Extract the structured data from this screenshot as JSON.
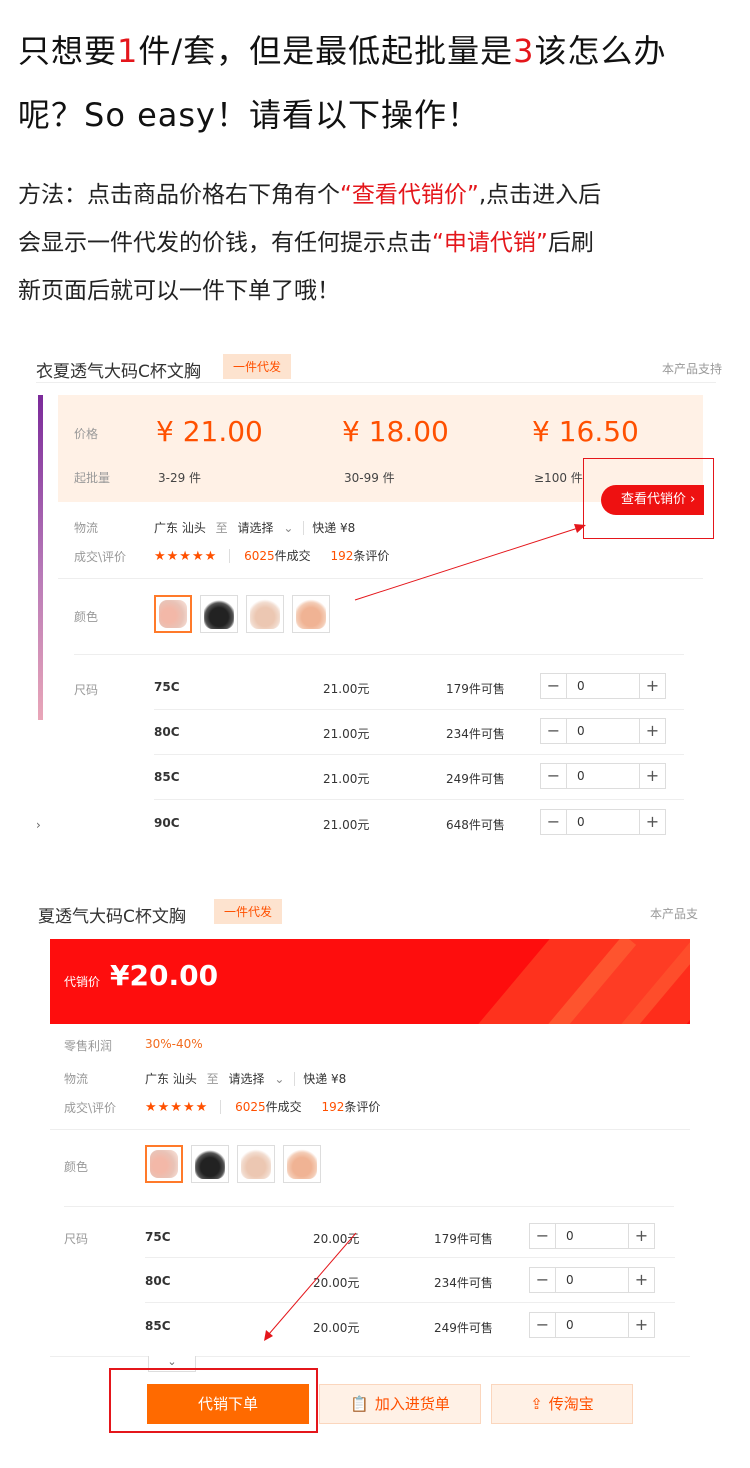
{
  "intro": {
    "line1_a": "只想要",
    "line1_num": "1",
    "line1_b": "件/套，但是最低起批量是",
    "line1_num2": "3",
    "line1_c": "该怎么办",
    "line2": "呢？So easy！请看以下操作！",
    "desc1_a": "方法：点击商品价格右下角有个",
    "desc1_q": "“查看代销价”",
    "desc1_b": ",点击进入后",
    "desc2_a": "会显示一件代发的价钱，有任何提示点击",
    "desc2_q": "“申请代销”",
    "desc2_b": "后刷",
    "desc3": "新页面后就可以一件下单了哦！"
  },
  "shot1": {
    "title": "衣夏透气大码C杯文胸",
    "badge": "一件代发",
    "support": "本产品支持",
    "price_label": "价格",
    "moq_label": "起批量",
    "prices": [
      {
        "price": "¥ 21.00",
        "moq": "3-29 件"
      },
      {
        "price": "¥ 18.00",
        "moq": "30-99 件"
      },
      {
        "price": "¥ 16.50",
        "moq": "≥100 件"
      }
    ],
    "cta": "查看代销价 ›",
    "logistics_label": "物流",
    "logistics_from": "广东 汕头",
    "logistics_to_word": "至",
    "logistics_dest": "请选择",
    "express": "快递 ¥8",
    "deal_label": "成交\\评价",
    "stars": "★★★★★",
    "deals_num": "6025",
    "deals_unit": "件成交",
    "reviews_num": "192",
    "reviews_unit": "条评价",
    "color_label": "颜色",
    "size_label": "尺码",
    "sizes": [
      {
        "size": "75C",
        "price": "21.00元",
        "stock": "179件可售",
        "qty": "0"
      },
      {
        "size": "80C",
        "price": "21.00元",
        "stock": "234件可售",
        "qty": "0"
      },
      {
        "size": "85C",
        "price": "21.00元",
        "stock": "249件可售",
        "qty": "0"
      },
      {
        "size": "90C",
        "price": "21.00元",
        "stock": "648件可售",
        "qty": "0"
      }
    ]
  },
  "shot2": {
    "title": "夏透气大码C杯文胸",
    "badge": "一件代发",
    "support": "本产品支",
    "dropship_label": "代销价",
    "dropship_price": "¥20.00",
    "profit_label": "零售利润",
    "profit_value": "30%-40%",
    "logistics_label": "物流",
    "logistics_from": "广东 汕头",
    "logistics_to_word": "至",
    "logistics_dest": "请选择",
    "express": "快递 ¥8",
    "deal_label": "成交\\评价",
    "stars": "★★★★★",
    "deals_num": "6025",
    "deals_unit": "件成交",
    "reviews_num": "192",
    "reviews_unit": "条评价",
    "color_label": "颜色",
    "size_label": "尺码",
    "sizes": [
      {
        "size": "75C",
        "price": "20.00元",
        "stock": "179件可售",
        "qty": "0"
      },
      {
        "size": "80C",
        "price": "20.00元",
        "stock": "234件可售",
        "qty": "0"
      },
      {
        "size": "85C",
        "price": "20.00元",
        "stock": "249件可售",
        "qty": "0"
      }
    ],
    "order_btn": "代销下单",
    "cart_btn": "加入进货单",
    "taobao_btn": "传淘宝"
  },
  "colors": {
    "accent": "#ff5000",
    "red": "#e4161b",
    "peach_bg": "#fff1e6"
  }
}
